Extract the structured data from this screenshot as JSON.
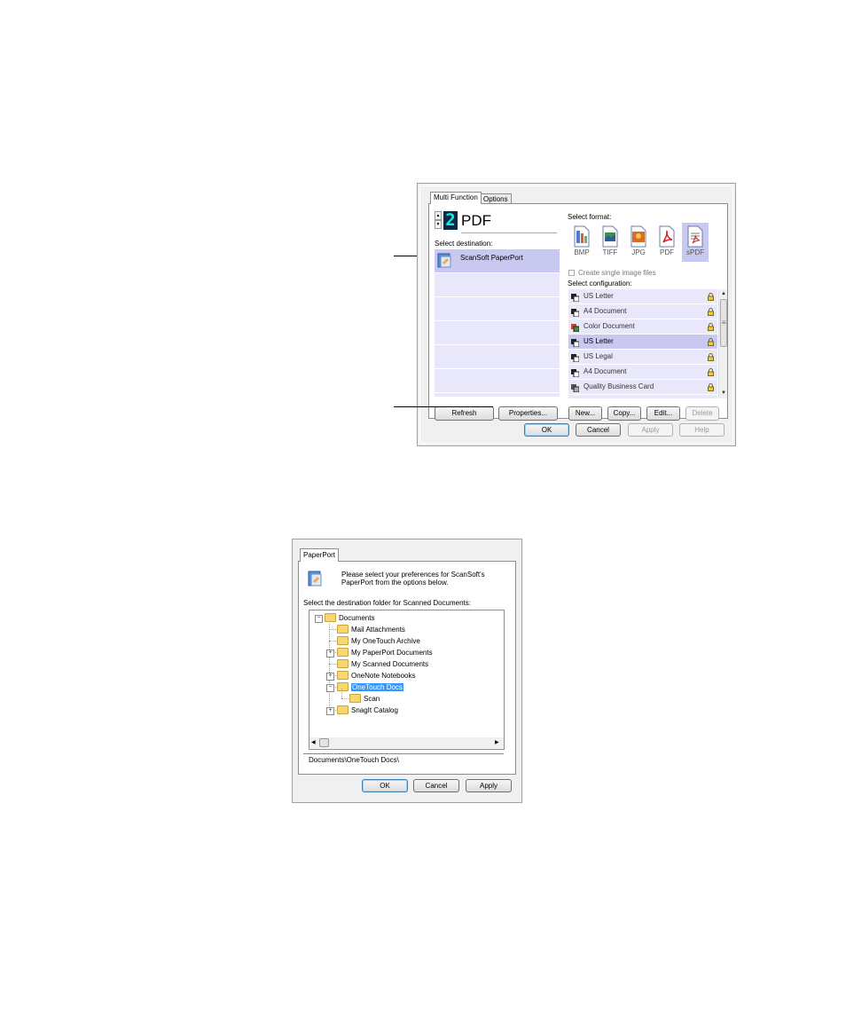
{
  "dialog1": {
    "tabs": [
      "Multi Function",
      "Options"
    ],
    "active_tab": "Multi Function",
    "counter_value": "2",
    "format_title": "PDF",
    "select_destination_label": "Select destination:",
    "destinations": [
      "ScanSoft PaperPort"
    ],
    "select_format_label": "Select format:",
    "formats": [
      {
        "label": "BMP",
        "icon": "bmp-file-icon"
      },
      {
        "label": "TIFF",
        "icon": "tiff-file-icon"
      },
      {
        "label": "JPG",
        "icon": "jpg-file-icon"
      },
      {
        "label": "PDF",
        "icon": "pdf-file-icon"
      },
      {
        "label": "sPDF",
        "icon": "spdf-file-icon"
      }
    ],
    "selected_format": "sPDF",
    "single_image_checkbox": "Create single image files",
    "select_configuration_label": "Select configuration:",
    "configurations": [
      "US Letter",
      "A4 Document",
      "Color Document",
      "US Letter",
      "US Legal",
      "A4 Document",
      "Quality Business Card"
    ],
    "selected_configuration_index": 3,
    "buttons": {
      "refresh": "Refresh",
      "properties": "Properties...",
      "new": "New...",
      "copy": "Copy...",
      "edit": "Edit...",
      "delete": "Delete",
      "ok": "OK",
      "cancel": "Cancel",
      "apply": "Apply",
      "help": "Help"
    }
  },
  "dialog2": {
    "tab": "PaperPort",
    "intro_text": "Please select your preferences for ScanSoft's PaperPort from the options below.",
    "tree_label": "Select the destination folder for Scanned Documents:",
    "tree": {
      "root": "Documents",
      "children": [
        {
          "label": "Mail Attachments",
          "expandable": false
        },
        {
          "label": "My OneTouch Archive",
          "expandable": false
        },
        {
          "label": "My PaperPort Documents",
          "expandable": true
        },
        {
          "label": "My Scanned Documents",
          "expandable": false
        },
        {
          "label": "OneNote Notebooks",
          "expandable": true
        },
        {
          "label": "OneTouch Docs",
          "expandable": true,
          "selected": true,
          "children": [
            "Scan"
          ]
        },
        {
          "label": "SnagIt Catalog",
          "expandable": true
        }
      ]
    },
    "path": "Documents\\OneTouch Docs\\",
    "buttons": {
      "ok": "OK",
      "cancel": "Cancel",
      "apply": "Apply"
    }
  }
}
